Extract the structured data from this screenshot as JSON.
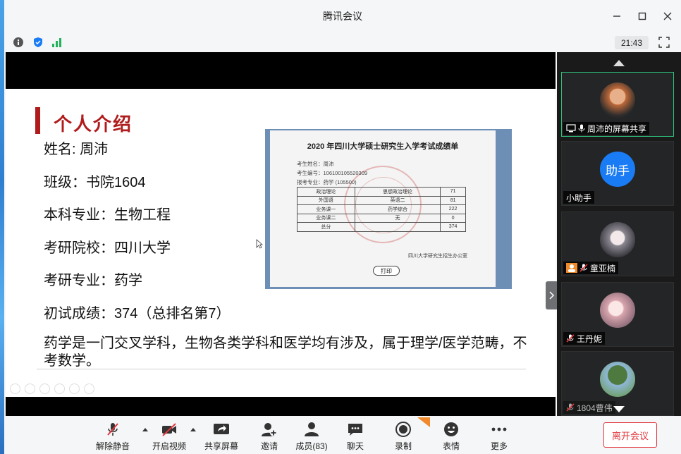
{
  "window": {
    "title": "腾讯会议",
    "clock": "21:43"
  },
  "slide": {
    "heading": "个人介绍",
    "lines": [
      "姓名: 周沛",
      "班级：书院1604",
      "本科专业：生物工程",
      "考研院校：四川大学",
      "考研专业：药学",
      "初试成绩：374（总排名第7）"
    ],
    "paragraph": "药学是一门交叉学科，生物各类学科和医学均有涉及，属于理学/医学范畴，不考数学。"
  },
  "report": {
    "title": "2020 年四川大学硕士研究生入学考试成绩单",
    "fields": [
      "考生姓名：周沛",
      "考生编号：106100105520309",
      "报考专业：药学 (105500)"
    ],
    "rows": [
      [
        "政治理论",
        "思想政治理论",
        "71"
      ],
      [
        "外国语",
        "英语二",
        "81"
      ],
      [
        "业务课一",
        "药学综合",
        "222"
      ],
      [
        "业务课二",
        "无",
        "0"
      ],
      [
        "总分",
        "",
        "374"
      ]
    ],
    "office": "四川大学研究生招生办公室",
    "print_label": "打印"
  },
  "participants": [
    {
      "name": "周沛的屏幕共享",
      "avatar": "person-photo-icon",
      "color": "#c06a3a"
    },
    {
      "name": "小助手",
      "avatar": "assistant-avatar",
      "avatar_text": "助手",
      "color": "#1a7cf5"
    },
    {
      "name": "童亚楠",
      "avatar": "anime-girl-photo-icon",
      "color": "#c9c3c9"
    },
    {
      "name": "王丹妮",
      "avatar": "anime-girl-photo-icon",
      "color": "#e6c5c9"
    },
    {
      "name": "1804曹伟",
      "avatar": "tree-photo-icon",
      "color": "#4f7a3f"
    }
  ],
  "toolbar": {
    "mute": "解除静音",
    "video": "开启视频",
    "share": "共享屏幕",
    "invite": "邀请",
    "members": "成员(83)",
    "chat": "聊天",
    "record": "录制",
    "reactions": "表情",
    "more": "更多",
    "leave": "离开会议"
  },
  "colors": {
    "accent_red": "#b01b1b",
    "leave_red": "#e0383e",
    "active_green": "#2fbe7a",
    "assistant_blue": "#1a7cf5"
  }
}
